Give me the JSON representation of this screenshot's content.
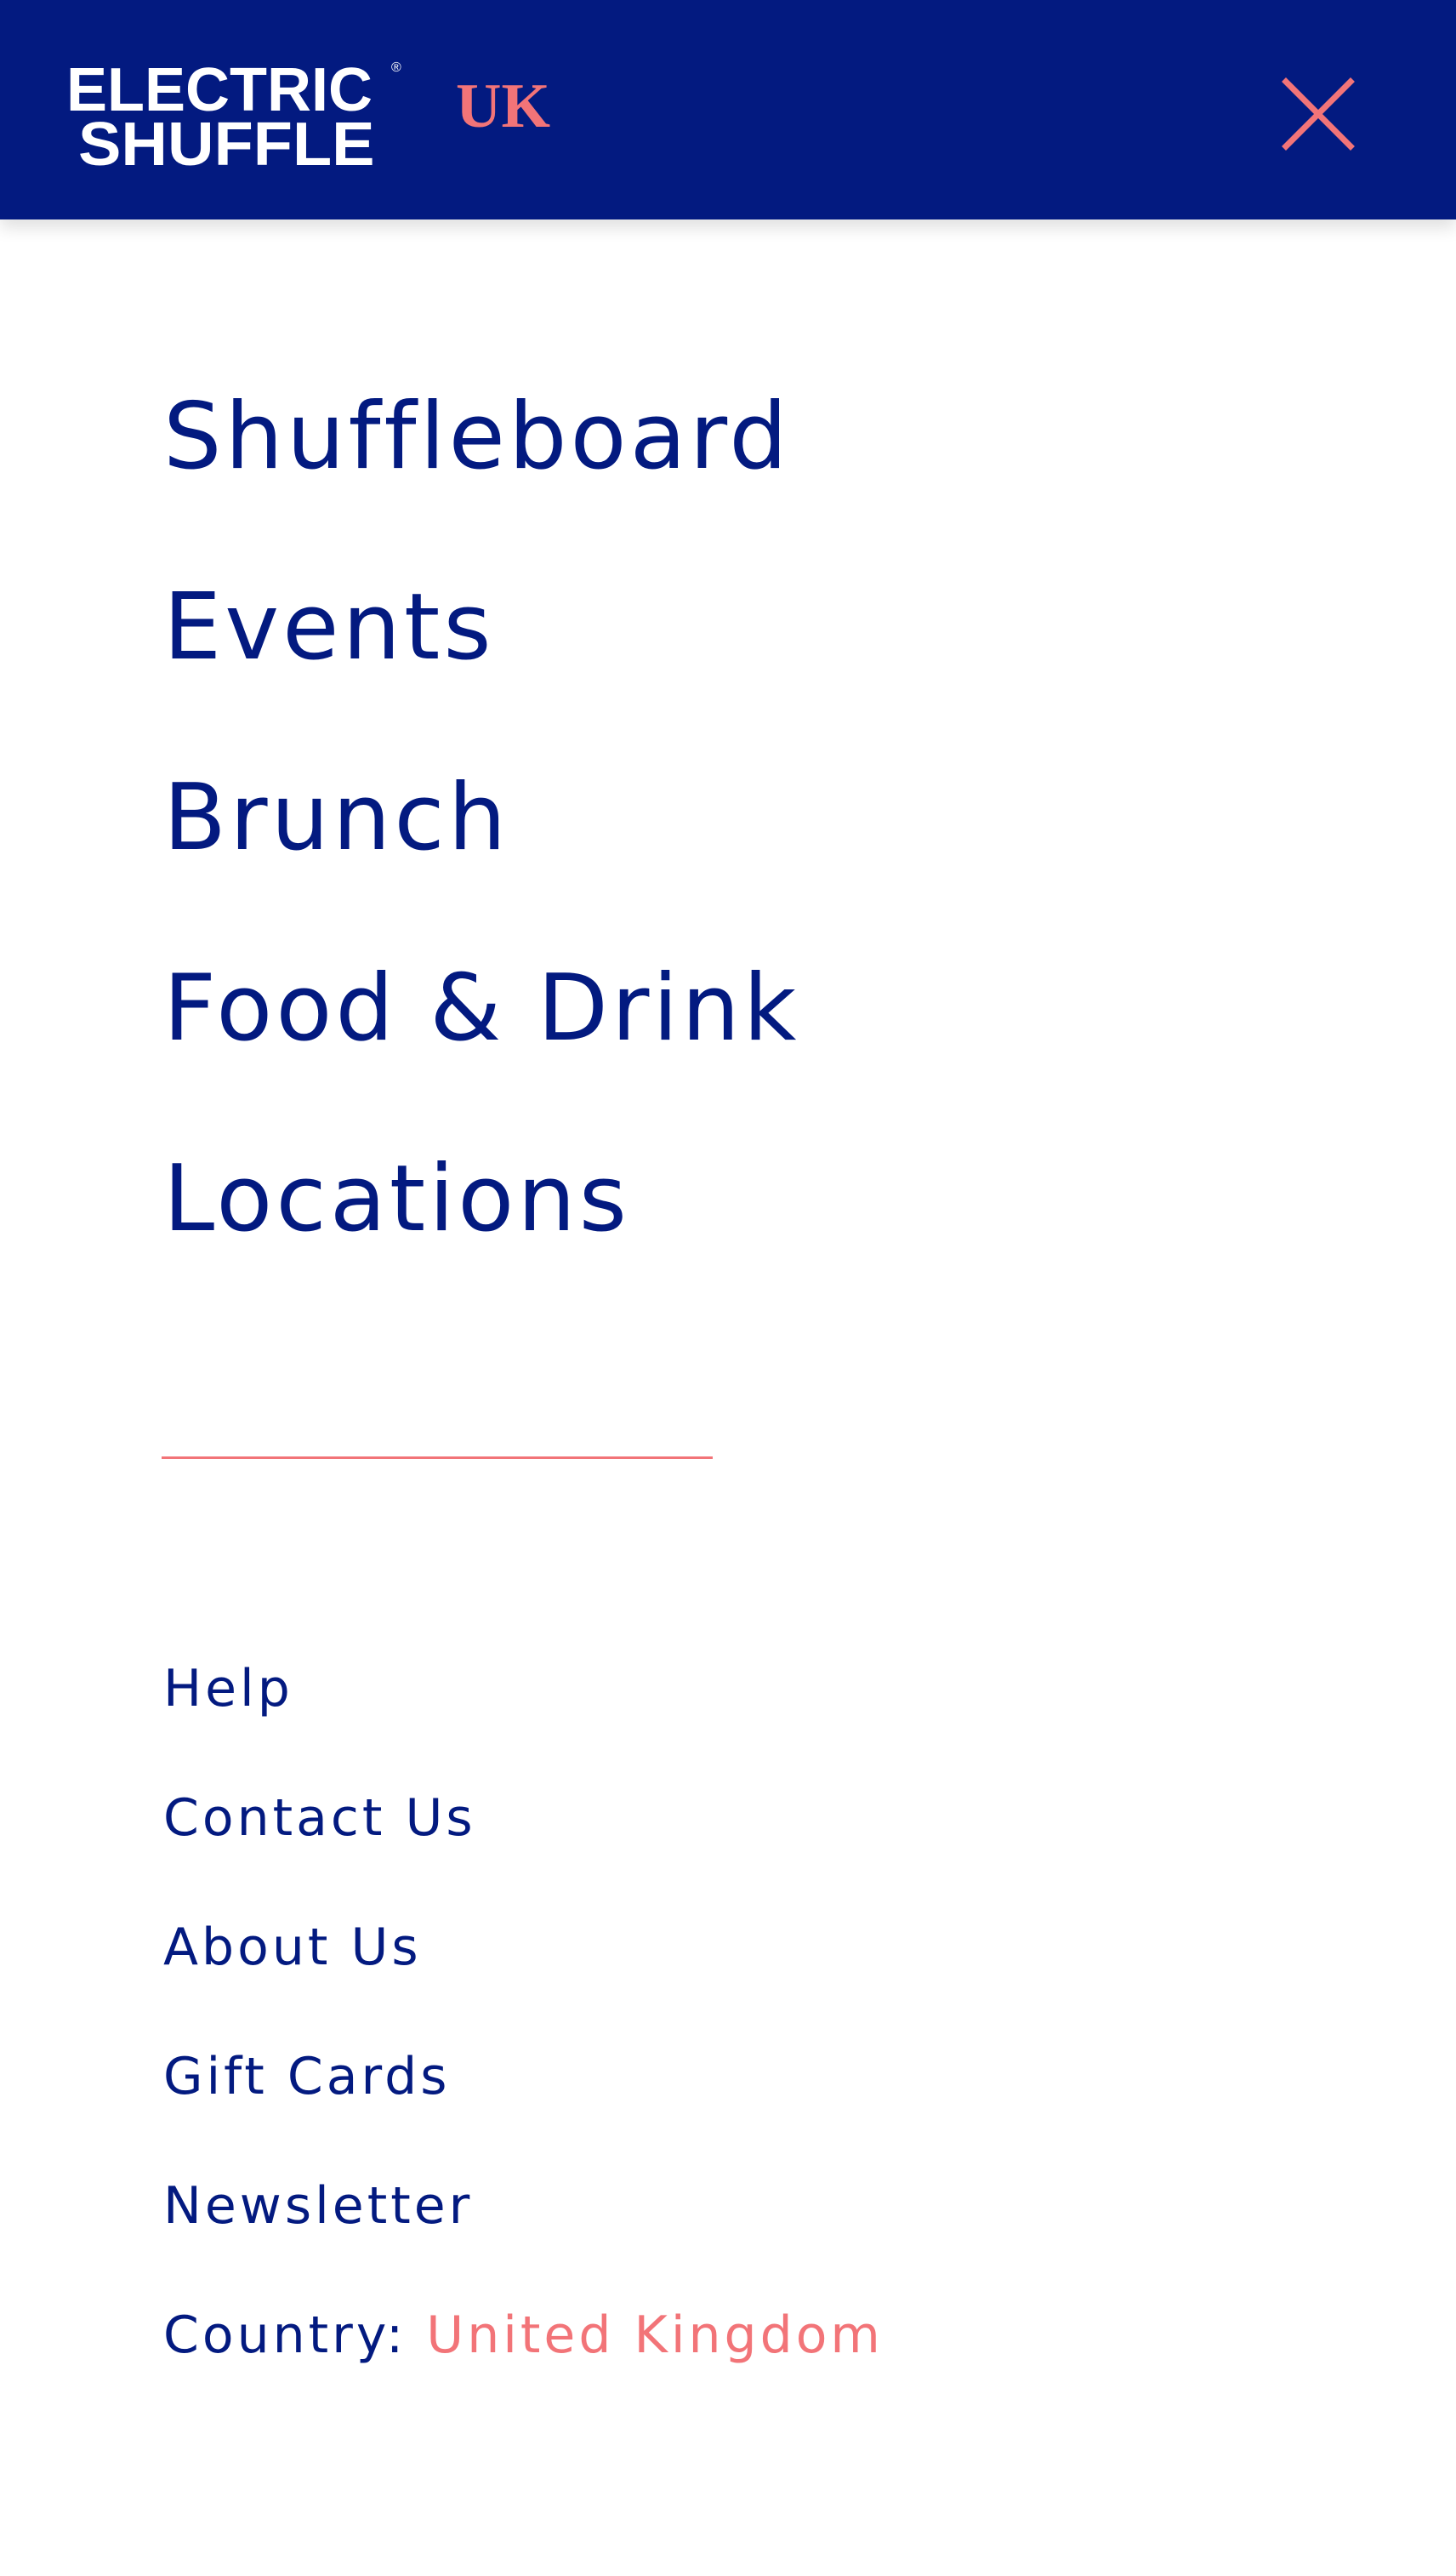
{
  "header": {
    "brand_line_1": "ELECTRIC",
    "brand_line_2": "SHUFFLE",
    "brand_registered_mark": "®",
    "region_label": "UK",
    "close_icon": "close-icon",
    "background_color": "#031a80",
    "accent_color": "#f27478"
  },
  "main_nav": {
    "items": [
      {
        "label": "Shuffleboard"
      },
      {
        "label": "Events"
      },
      {
        "label": "Brunch"
      },
      {
        "label": "Food & Drink"
      },
      {
        "label": "Locations"
      }
    ]
  },
  "secondary_nav": {
    "items": [
      {
        "label": "Help"
      },
      {
        "label": "Contact Us"
      },
      {
        "label": "About Us"
      },
      {
        "label": "Gift Cards"
      },
      {
        "label": "Newsletter"
      }
    ]
  },
  "country": {
    "label": "Country:",
    "value": "United Kingdom"
  },
  "colors": {
    "text_primary": "#031a80",
    "accent": "#f27478",
    "background": "#ffffff"
  }
}
